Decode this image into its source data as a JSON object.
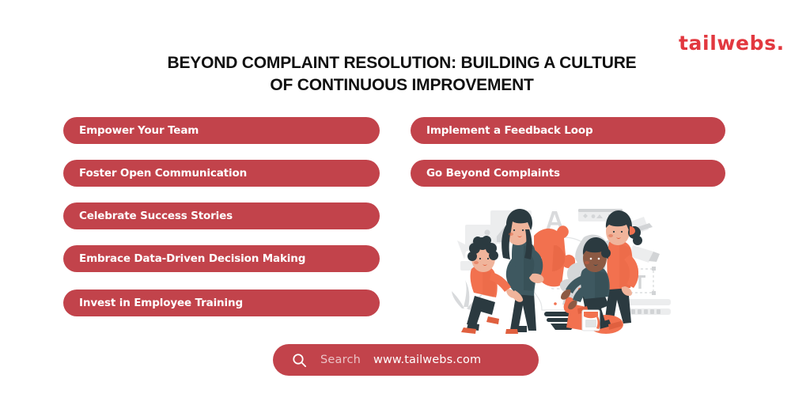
{
  "brand": {
    "logo_text": "tailwebs.",
    "logo_color": "#E2383F"
  },
  "header": {
    "title_line_1": "BEYOND COMPLAINT RESOLUTION: BUILDING A CULTURE",
    "title_line_2": "OF CONTINUOUS IMPROVEMENT",
    "title_color": "#111111"
  },
  "theme": {
    "pill_red": "#C2434B",
    "pill_text": "#FFFFFF",
    "illustration_coral": "#F2714F",
    "illustration_teal": "#3E5860",
    "illustration_grey": "#D7D9DB",
    "background": "#FFFFFF"
  },
  "pills": {
    "left_column": [
      {
        "label": "Empower Your Team"
      },
      {
        "label": "Foster Open Communication"
      },
      {
        "label": "Celebrate Success Stories"
      },
      {
        "label": "Embrace Data-Driven Decision Making"
      },
      {
        "label": "Invest in Employee Training"
      }
    ],
    "right_column": [
      {
        "label": "Implement a Feedback Loop"
      },
      {
        "label": "Go Beyond Complaints"
      }
    ]
  },
  "illustration": {
    "name": "team-assembling-lightbulb-puzzle-illustration",
    "alt": "Four people assembling a large puzzle shaped like a lightbulb"
  },
  "search": {
    "icon": "search-icon",
    "placeholder": "Search",
    "url": "www.tailwebs.com"
  }
}
